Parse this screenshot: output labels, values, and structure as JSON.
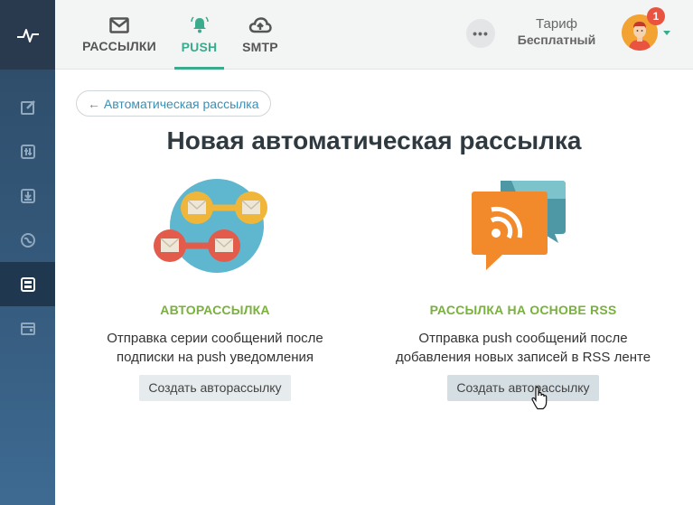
{
  "sidebar": {
    "items": [
      {
        "icon": "edit-icon"
      },
      {
        "icon": "sliders-icon"
      },
      {
        "icon": "inbox-icon"
      },
      {
        "icon": "globe-icon"
      },
      {
        "icon": "automation-icon",
        "active": true
      },
      {
        "icon": "wallet-icon"
      }
    ]
  },
  "header": {
    "tabs": [
      {
        "label": "РАССЫЛКИ",
        "icon": "envelope-icon"
      },
      {
        "label": "PUSH",
        "icon": "bell-icon",
        "active": true
      },
      {
        "label": "SMTP",
        "icon": "cloud-upload-icon"
      }
    ],
    "more_label": "•••",
    "tariff_label": "Тариф",
    "tariff_value": "Бесплатный",
    "notification_count": "1"
  },
  "main": {
    "back_label": "← Автоматическая рассылка",
    "title": "Новая автоматическая рассылка",
    "cards": [
      {
        "title": "АВТОРАССЫЛКА",
        "desc_line1": "Отправка серии сообщений после",
        "desc_line2": "подписки на push уведомления",
        "button": "Создать авторассылку"
      },
      {
        "title": "РАССЫЛКА НА ОСНОВЕ RSS",
        "desc_line1": "Отправка push сообщений после",
        "desc_line2": "добавления новых записей в RSS ленте",
        "button": "Создать авторассылку"
      }
    ]
  },
  "colors": {
    "accent": "#3aab8c",
    "card_title": "#78b13b",
    "link": "#3c8fb4",
    "badge": "#e8543f"
  }
}
